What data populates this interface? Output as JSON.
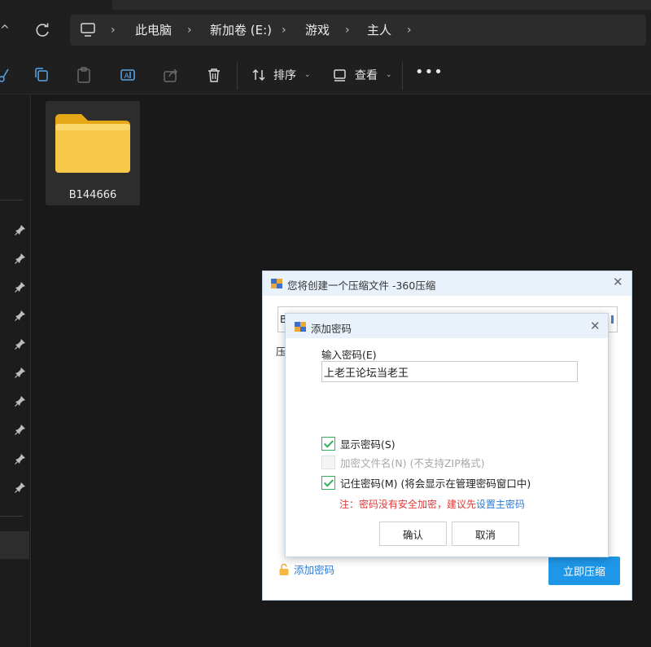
{
  "window": {
    "addressbar": {
      "breadcrumbs": [
        "此电脑",
        "新加卷 (E:)",
        "游戏",
        "主人"
      ]
    },
    "commandbar": {
      "sort_label": "排序",
      "view_label": "查看",
      "more_label": "•••"
    },
    "content": {
      "items": [
        {
          "name": "B144666",
          "type": "folder"
        }
      ]
    }
  },
  "compress_dialog": {
    "title": "您将创建一个压缩文件 -360压缩",
    "path_value_visible": "B",
    "label_partial": "压",
    "add_password_link": "添加密码",
    "compress_button": "立即压缩"
  },
  "password_dialog": {
    "title": "添加密码",
    "input_label": "输入密码(E)",
    "input_value": "上老王论坛当老王",
    "options": [
      {
        "label": "显示密码(S)",
        "checked": true,
        "enabled": true
      },
      {
        "label": "加密文件名(N) (不支持ZIP格式)",
        "checked": false,
        "enabled": false
      },
      {
        "label": "记住密码(M) (将会显示在管理密码窗口中)",
        "checked": true,
        "enabled": true
      }
    ],
    "note_text": "注：密码没有安全加密，建议先",
    "note_link": "设置主密码",
    "ok_button": "确认",
    "cancel_button": "取消"
  },
  "colors": {
    "explorer_bg": "#191919",
    "accent_blue": "#1e97e8",
    "check_green": "#2db35b",
    "warning_red": "#e03a3a",
    "folder_yellow": "#f7c948"
  }
}
